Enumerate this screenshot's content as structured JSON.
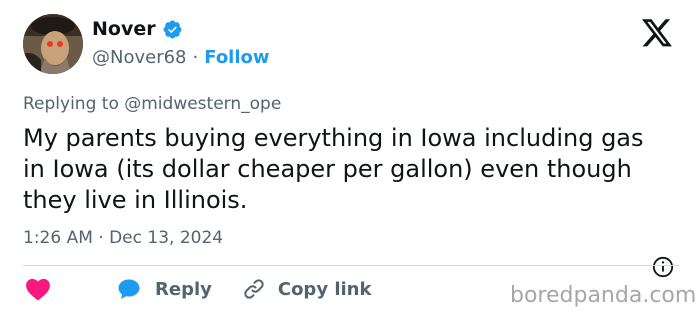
{
  "author": {
    "display_name": "Nover",
    "handle": "@Nover68",
    "separator": "·",
    "follow_label": "Follow"
  },
  "reply_context": {
    "prefix": "Replying to",
    "mention": "@midwestern_ope"
  },
  "tweet": {
    "text": "My parents buying everything in Iowa including gas in Iowa (its dollar cheaper per gallon) even though they live in Illinois.",
    "timestamp": "1:26 AM · Dec 13, 2024"
  },
  "actions": {
    "reply_label": "Reply",
    "copy_link_label": "Copy link"
  },
  "watermark": "boredpanda.com",
  "colors": {
    "accent": "#1d9bf0",
    "heart": "#f91880",
    "secondary_text": "#536471",
    "primary_text": "#0f1419"
  },
  "icons": {
    "verified": "verified-badge-icon",
    "platform": "x-logo-icon",
    "info": "info-icon",
    "like": "heart-icon",
    "reply": "reply-bubble-icon",
    "copy_link": "link-icon"
  }
}
